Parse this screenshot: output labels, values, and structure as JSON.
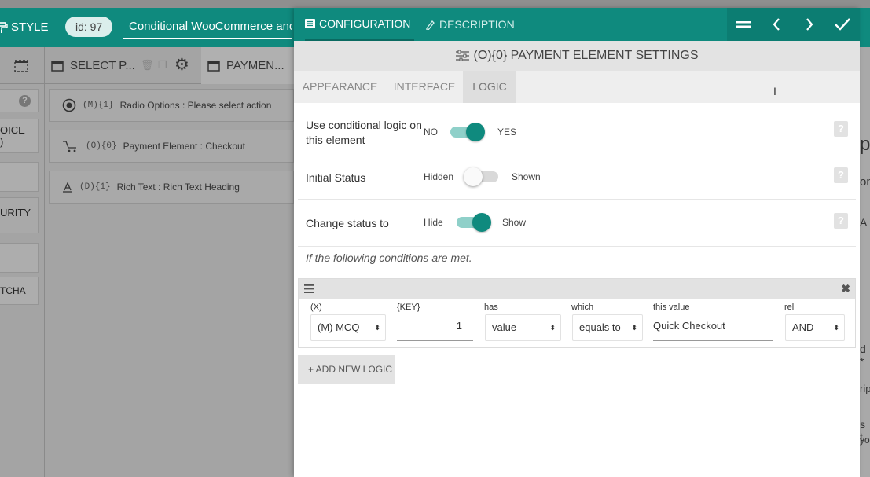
{
  "background": {
    "header": {
      "style_label": "STYLE",
      "id_badge": "id: 97",
      "form_title": "Conditional WooCommerce and"
    },
    "left_column": {
      "items": [
        "OICE\n)",
        "URITY",
        "TCHA"
      ],
      "help": "?"
    },
    "panel_tabs": [
      {
        "label": "SELECT P...",
        "active": false
      },
      {
        "label": "PAYMEN...",
        "active": true
      }
    ],
    "fields": [
      {
        "code": "(M){1}",
        "label": "Radio Options : Please select action",
        "icon": "radio-icon"
      },
      {
        "code": "(O){0}",
        "label": "Payment Element : Checkout",
        "icon": "cart-icon"
      },
      {
        "code": "(D){1}",
        "label": "Rich Text : Rich Text Heading",
        "icon": "rich-text-icon"
      }
    ],
    "right_peek": [
      "p",
      "on",
      "A",
      "d *",
      "rip",
      "s t",
      "yo"
    ]
  },
  "modal": {
    "tabs": [
      {
        "label": "CONFIGURATION",
        "icon": "list-icon",
        "active": true
      },
      {
        "label": "DESCRIPTION",
        "icon": "pen-icon",
        "active": false
      }
    ],
    "subtitle": "(O){0} PAYMENT ELEMENT SETTINGS",
    "subtabs": [
      {
        "label": "APPEARANCE",
        "active": false
      },
      {
        "label": "INTERFACE",
        "active": false
      },
      {
        "label": "LOGIC",
        "active": true
      }
    ],
    "settings": [
      {
        "label": "Use conditional logic on this element",
        "off_text": "NO",
        "on_text": "YES",
        "state": true
      },
      {
        "label": "Initial Status",
        "off_text": "Hidden",
        "on_text": "Shown",
        "state": false
      },
      {
        "label": "Change status to",
        "off_text": "Hide",
        "on_text": "Show",
        "state": true
      }
    ],
    "help_badge": "?",
    "conditions_note": "If the following conditions are met.",
    "logic": {
      "columns": [
        "(X)",
        "{KEY}",
        "has",
        "which",
        "this value",
        "rel"
      ],
      "row": {
        "field": "(M) MCQ",
        "key": "1",
        "has": "value",
        "which": "equals to",
        "value": "Quick Checkout",
        "rel": "AND"
      }
    },
    "add_logic_label": "+ ADD NEW LOGIC"
  }
}
